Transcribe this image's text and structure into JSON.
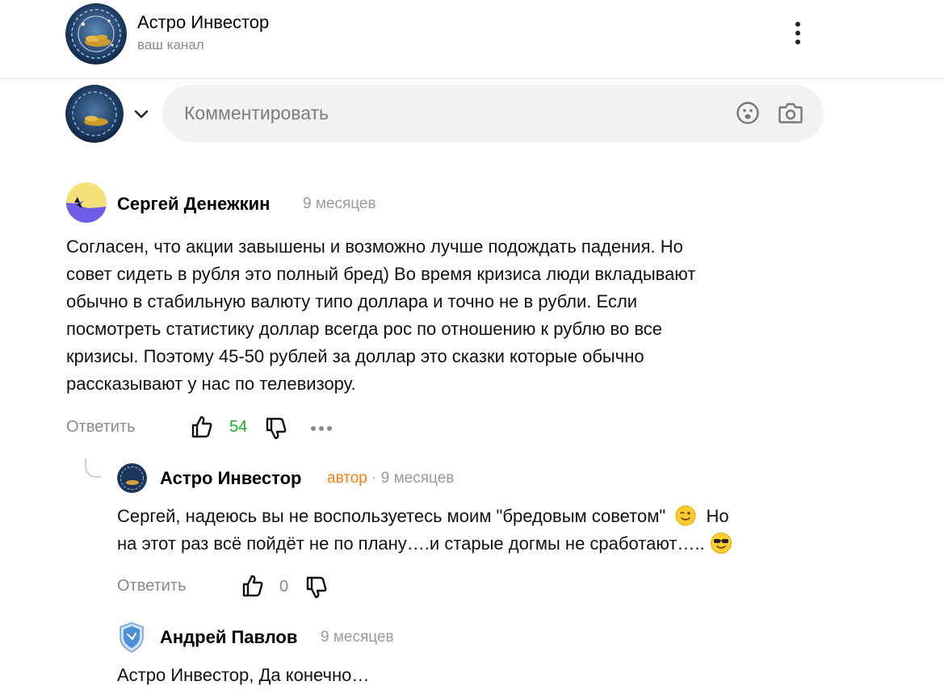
{
  "channel": {
    "name": "Астро Инвестор",
    "subtitle": "ваш канал",
    "avatar_icon": "zodiac-coins-avatar"
  },
  "composer": {
    "placeholder": "Комментировать",
    "emoji_icon": "emoji-icon",
    "camera_icon": "camera-icon"
  },
  "colors": {
    "like_count": "#1eaa32",
    "author_badge": "#f07c1a",
    "composer_bg": "#f2f2f2"
  },
  "comments": [
    {
      "author": "Сергей Денежкин",
      "time": "9 месяцев",
      "text": [
        "Согласен, что акции завышены и возможно лучше подождать падения. Но",
        "совет сидеть в рубля это полный бред) Во время кризиса люди вкладывают",
        "обычно в стабильную валюту типо доллара и точно не в рубли. Если",
        "посмотреть статистику доллар всегда рос по отношению к рублю во все",
        "кризисы. Поэтому 45-50 рублей за доллар это сказки которые обычно",
        "рассказывают у нас по телевизору."
      ],
      "reply_label": "Ответить",
      "likes": "54"
    },
    {
      "author": "Астро Инвестор",
      "badge": "автор",
      "time": "· 9 месяцев",
      "text": [
        "Сергей, надеюсь вы не воспользуетесь моим \"бредовым советом\"",
        "Но",
        "на этот раз всё пойдёт не по плану….и старые догмы не сработают….."
      ],
      "reply_label": "Ответить",
      "likes": "0"
    },
    {
      "author": "Андрей Павлов",
      "time": "9 месяцев",
      "text": [
        "Астро Инвестор, Да конечно…"
      ]
    }
  ]
}
